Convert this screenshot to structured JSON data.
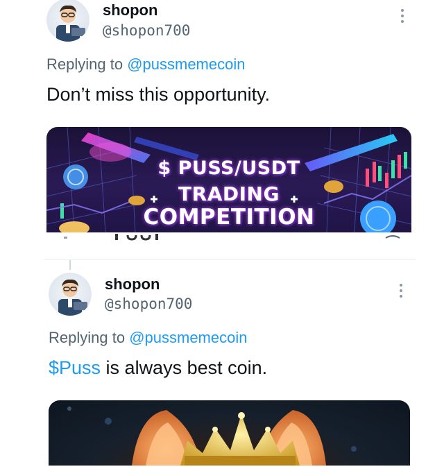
{
  "tweets": [
    {
      "name": "shopon",
      "handle": "@shopon700",
      "replying_prefix": "Replying to ",
      "replying_to": "@pussmemecoin",
      "text_prefix": "",
      "cashtag": "",
      "text": "Don’t miss this opportunity.",
      "media": {
        "line1": "$ PUSS/USDT",
        "line2": "TRADING",
        "line3": "COMPETITION"
      }
    },
    {
      "name": "shopon",
      "handle": "@shopon700",
      "replying_prefix": "Replying to ",
      "replying_to": "@pussmemecoin",
      "cashtag": "$Puss",
      "text": " is always best coin."
    }
  ],
  "icons": {
    "more": "more-vertical-icon",
    "avatar": "user-avatar-illustration"
  },
  "colors": {
    "link": "#1d9bf0",
    "secondary_text": "#536471",
    "primary_text": "#0f1419"
  }
}
